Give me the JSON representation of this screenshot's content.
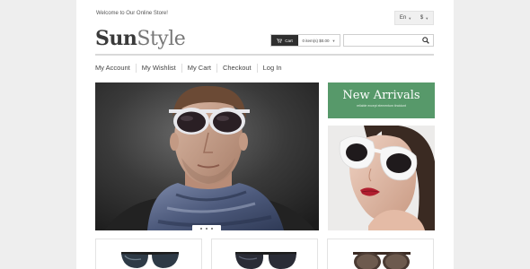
{
  "header": {
    "welcome": "Welcome to Our Online Store!",
    "language": "En",
    "currency": "$"
  },
  "logo": {
    "part1": "Sun",
    "part2": "Style"
  },
  "cart": {
    "button_label": "Cart",
    "summary": "0 item(s) $0.00"
  },
  "search": {
    "placeholder": ""
  },
  "nav": {
    "items": [
      "My Account",
      "My Wishlist",
      "My Cart",
      "Checkout",
      "Log In"
    ]
  },
  "banner": {
    "title": "New Arrivals",
    "subtitle": "reliable except elementum tincidunt",
    "color": "#57996a"
  },
  "icons": {
    "cart": "cart-icon",
    "search": "search-icon",
    "caret": "chevron-down-icon"
  }
}
